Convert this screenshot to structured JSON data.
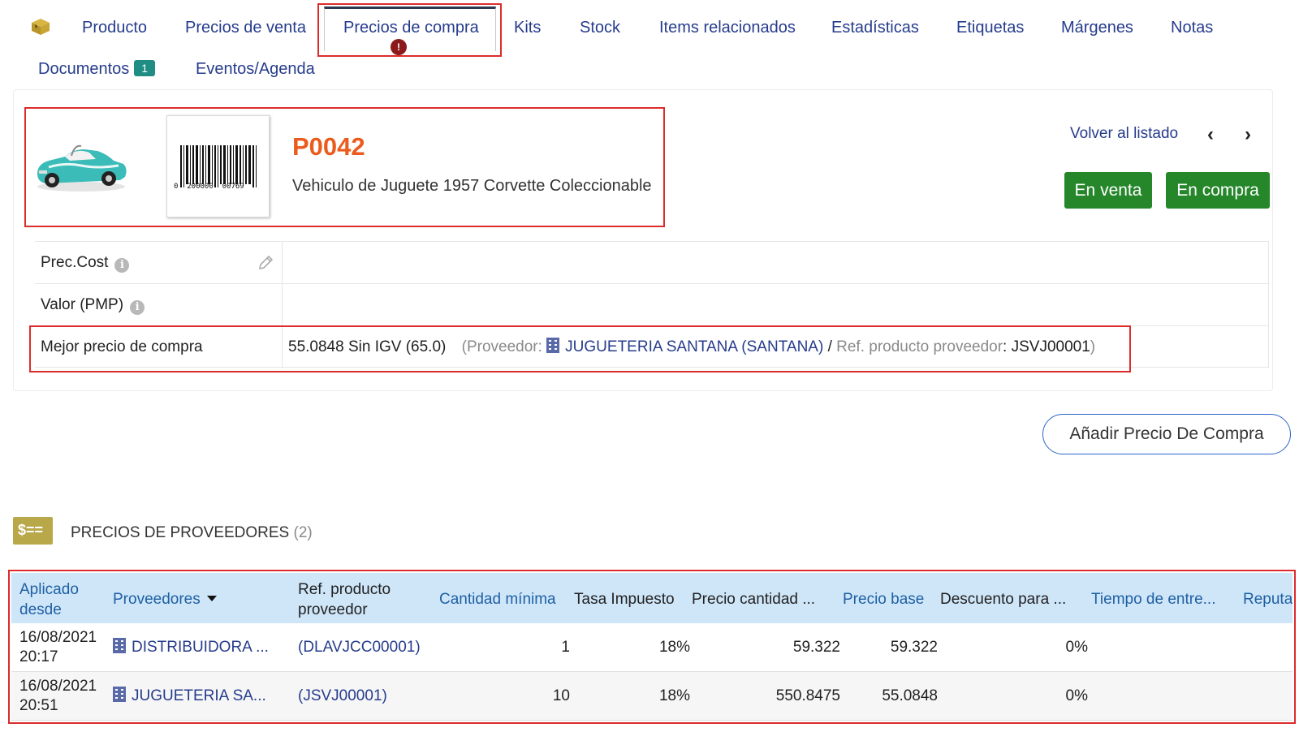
{
  "tabs": {
    "producto": "Producto",
    "precios_venta": "Precios de venta",
    "precios_compra": "Precios de compra",
    "precios_compra_badge": "!",
    "kits": "Kits",
    "stock": "Stock",
    "items_relacionados": "Items relacionados",
    "estadisticas": "Estadísticas",
    "etiquetas": "Etiquetas",
    "margenes": "Márgenes",
    "notas": "Notas",
    "documentos": "Documentos",
    "documentos_count": "1",
    "eventos": "Eventos/Agenda"
  },
  "product": {
    "ref": "P0042",
    "label": "Vehiculo de Juguete 1957 Corvette Coleccionable",
    "barcode_text": "0  200000  00769"
  },
  "nav": {
    "back": "Volver al listado",
    "prev": "‹",
    "next": "›"
  },
  "status_buttons": {
    "sell": "En venta",
    "buy": "En compra"
  },
  "fields": {
    "cost_label": "Prec.Cost",
    "pmp_label": "Valor (PMP)",
    "best_label": "Mejor precio de compra",
    "best_value": "55.0848 Sin IGV (65.0)",
    "best_open": "(Proveedor: ",
    "best_supplier": "JUGUETERIA SANTANA (SANTANA)",
    "best_sep": " / ",
    "best_ref_label": "Ref. producto proveedor",
    "best_ref_value": ": JSVJ00001",
    "best_close": ")"
  },
  "add_button": "Añadir Precio De Compra",
  "section": {
    "icon_text": "$==",
    "title": "PRECIOS DE PROVEEDORES",
    "count": " (2)"
  },
  "table": {
    "headers": {
      "aplicado_1": "Aplicado",
      "aplicado_2": "desde",
      "proveedores": "Proveedores",
      "ref_1": "Ref. producto",
      "ref_2": "proveedor",
      "cantidad": "Cantidad mínima",
      "tasa": "Tasa Impuesto",
      "precio_cantidad": "Precio cantidad ...",
      "precio_base": "Precio base",
      "descuento": "Descuento para ...",
      "tiempo": "Tiempo de entre...",
      "reputacion": "Reputa"
    },
    "rows": [
      {
        "date": "16/08/2021",
        "time": "20:17",
        "supplier": "DISTRIBUIDORA ...",
        "ref": "(DLAVJCC00001)",
        "qty": "1",
        "tax": "18%",
        "price_qty": "59.322",
        "price_base": "59.322",
        "discount": "0%"
      },
      {
        "date": "16/08/2021",
        "time": "20:51",
        "supplier": "JUGUETERIA SA...",
        "ref": "(JSVJ00001)",
        "qty": "10",
        "tax": "18%",
        "price_qty": "550.8475",
        "price_base": "55.0848",
        "discount": "0%"
      }
    ]
  },
  "colors": {
    "link": "#263c8c",
    "ref_orange": "#ec5b1e",
    "green_button": "#25862a",
    "highlight_red": "#dd2b2b",
    "table_header": "#cfe6f9"
  }
}
